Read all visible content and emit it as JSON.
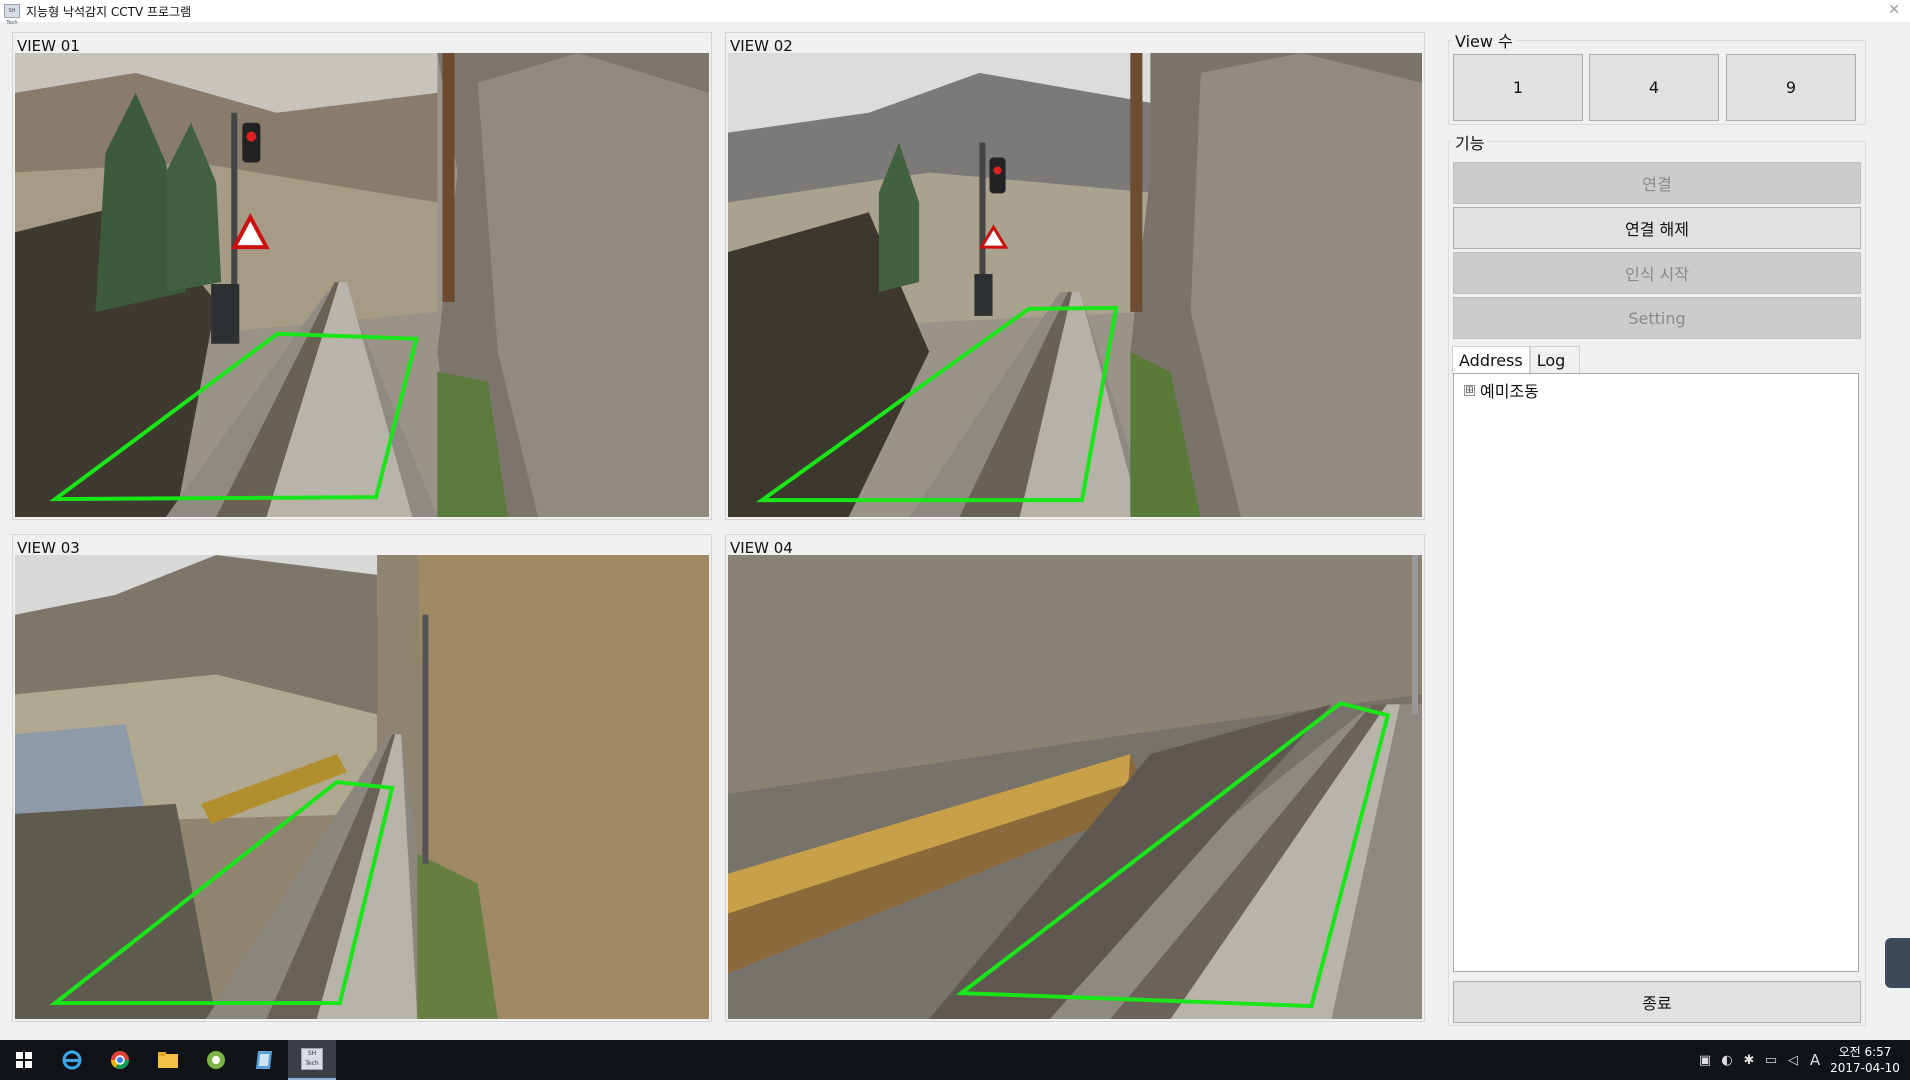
{
  "window": {
    "title": "지능형 낙석감지 CCTV 프로그램",
    "icon_text": "SH Tech"
  },
  "views": [
    {
      "label": "VIEW 01",
      "scene": "rock-cut-signal"
    },
    {
      "label": "VIEW 02",
      "scene": "rock-cut-signal"
    },
    {
      "label": "VIEW 03",
      "scene": "hillside-fence"
    },
    {
      "label": "VIEW 04",
      "scene": "bridge-curve"
    }
  ],
  "view_count": {
    "title": "View 수",
    "buttons": [
      "1",
      "4",
      "9"
    ]
  },
  "functions": {
    "title": "기능",
    "connect": "연결",
    "disconnect": "연결 해제",
    "start_detection": "인식 시작",
    "setting": "Setting"
  },
  "tabs": {
    "address": "Address",
    "log": "Log"
  },
  "tree": {
    "items": [
      {
        "label": "예미조동",
        "expander": "⊞"
      }
    ]
  },
  "exit_button": "종료",
  "taskbar": {
    "apps": [
      "start-icon",
      "internet-explorer-icon",
      "chrome-icon",
      "file-explorer-icon",
      "green-app-icon",
      "notepad-icon",
      "sh-tech-app-icon"
    ],
    "active_app_text": "SH Tech",
    "clock_time": "오전 6:57",
    "clock_date": "2017-04-10",
    "ime": "A"
  },
  "colors": {
    "roi": "#19e619",
    "taskbar": "#101419",
    "disabled": "#cccccc"
  }
}
